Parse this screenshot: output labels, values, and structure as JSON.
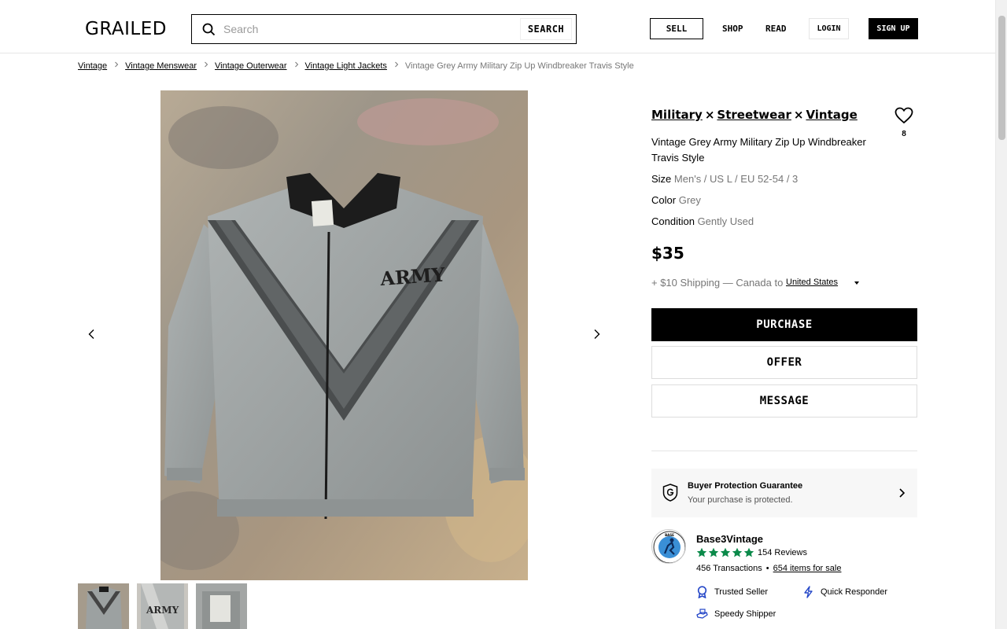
{
  "header": {
    "logo": "GRAILED",
    "search_placeholder": "Search",
    "search_button": "SEARCH",
    "nav_sell": "SELL",
    "nav_shop": "SHOP",
    "nav_read": "READ",
    "nav_login": "LOGIN",
    "nav_signup": "SIGN UP"
  },
  "breadcrumbs": [
    "Vintage",
    "Vintage Menswear",
    "Vintage Outerwear",
    "Vintage Light Jackets"
  ],
  "breadcrumb_current": "Vintage Grey Army Military Zip Up Windbreaker Travis Style",
  "gallery": {
    "image_text": "ARMY",
    "thumb_text": "ARMY"
  },
  "listing": {
    "brands": [
      "Military",
      "Streetwear",
      "Vintage"
    ],
    "brand_separator": "×",
    "favorites": "8",
    "title": "Vintage Grey Army Military Zip Up Windbreaker Travis Style",
    "size_label": "Size",
    "size_value": "Men's / US L / EU 52-54 / 3",
    "color_label": "Color",
    "color_value": "Grey",
    "condition_label": "Condition",
    "condition_value": "Gently Used",
    "price": "$35",
    "shipping": "+ $10 Shipping — Canada to",
    "ship_country": "United States",
    "purchase": "PURCHASE",
    "offer": "OFFER",
    "message": "MESSAGE"
  },
  "protection": {
    "title": "Buyer Protection Guarantee",
    "subtitle": "Your purchase is protected."
  },
  "seller": {
    "name": "Base3Vintage",
    "avatar_text": "BASE",
    "rating": 5,
    "reviews": "154 Reviews",
    "transactions": "456 Transactions",
    "dot": "•",
    "items_for_sale": "654 items for sale",
    "badges": [
      "Trusted Seller",
      "Quick Responder",
      "Speedy Shipper"
    ]
  },
  "colors": {
    "accent_green": "#0b8a4a",
    "badge_blue": "#2446c7"
  }
}
